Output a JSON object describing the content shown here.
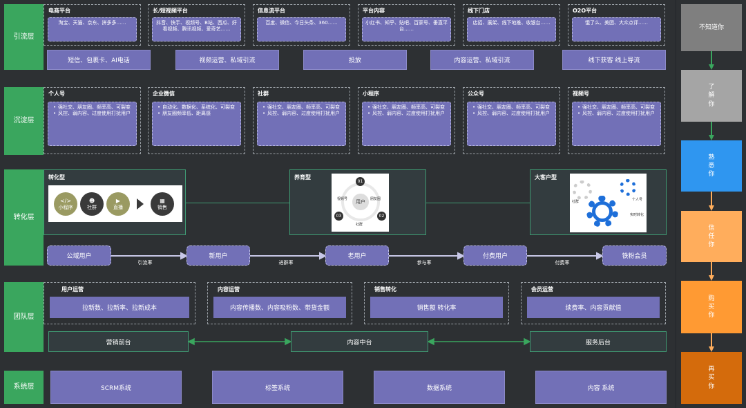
{
  "layers": {
    "l1": "引流层",
    "l2": "沉淀层",
    "l3": "转化层",
    "l4": "团队层",
    "l5": "系统层"
  },
  "traffic": {
    "platforms": [
      {
        "title": "电商平台",
        "desc": "淘宝、天猫、京东、拼多多……"
      },
      {
        "title": "长/短视频平台",
        "desc": "抖音、快手、视频号、B站、西瓜、好看视频、腾讯视频、爱奇艺……"
      },
      {
        "title": "信息流平台",
        "desc": "百度、微信、今日头条、360……"
      },
      {
        "title": "平台内容",
        "desc": "小红书、知乎、贴吧、百家号、垂直平台……"
      },
      {
        "title": "线下门店",
        "desc": "店招、展架、线下地推、收银台……"
      },
      {
        "title": "O2O平台",
        "desc": "饿了么、美团、大众点评……"
      }
    ],
    "methods": [
      "短信、包裹卡、AI电话",
      "视频运营、私域引流",
      "投放",
      "内容运营、私域引流",
      "线下获客 线上导流"
    ]
  },
  "retention": [
    {
      "title": "个人号",
      "bullets": [
        "强社交、朋友圈、频率高、可裂变",
        "风控、弱内容、过度使用打扰用户"
      ]
    },
    {
      "title": "企业微信",
      "bullets": [
        "自动化、数据化、系统化、可裂变",
        "朋友圈频率低、距离感"
      ]
    },
    {
      "title": "社群",
      "bullets": [
        "强社交、朋友圈、频率高、可裂变",
        "风控、弱内容、过度使用打扰用户"
      ]
    },
    {
      "title": "小程序",
      "bullets": [
        "强社交、朋友圈、频率高、可裂变",
        "风控、弱内容、过度使用打扰用户"
      ]
    },
    {
      "title": "公众号",
      "bullets": [
        "强社交、朋友圈、频率高、可裂变",
        "风控、弱内容、过度使用打扰用户"
      ]
    },
    {
      "title": "视频号",
      "bullets": [
        "强社交、朋友圈、频率高、可裂变",
        "风控、弱内容、过度使用打扰用户"
      ]
    }
  ],
  "conversion": {
    "types": {
      "t1": "转化型",
      "t2": "养育型",
      "t3": "大客户型"
    },
    "conv_flow": {
      "n1": "小程序",
      "n2": "社群",
      "n3": "直播",
      "n4": "销售"
    },
    "nurture": {
      "center": "用户",
      "c1": "01",
      "c2": "02",
      "c3": "03",
      "l_left": "视频号",
      "l_right": "朋友圈",
      "l_bottom": "社群"
    },
    "bigclient": {
      "g1": "社群",
      "g2": "个人号",
      "g3": "实时转化"
    },
    "funnel": [
      "公域用户",
      "新用户",
      "老用户",
      "付费用户",
      "铁粉会员"
    ],
    "rates": [
      "引流率",
      "进群率",
      "参与率",
      "付费率"
    ]
  },
  "team": {
    "roles": [
      {
        "title": "用户运营",
        "metric": "拉新数、拉新率、拉新成本"
      },
      {
        "title": "内容运营",
        "metric": "内容传播数、内容吸粉数、带货金额"
      },
      {
        "title": "销售转化",
        "metric": "销售额 转化率"
      },
      {
        "title": "会员运营",
        "metric": "续费率、内容贡献值"
      }
    ],
    "platforms": [
      "营销前台",
      "内容中台",
      "服务后台"
    ]
  },
  "systems": [
    "SCRM系统",
    "标签系统",
    "数据系统",
    "内容 系统"
  ],
  "journey": [
    {
      "label": "不知道你",
      "color": "#7f7f7f"
    },
    {
      "label": "了解你",
      "color": "#a5a5a5"
    },
    {
      "label": "熟悉你",
      "color": "#2f96f0"
    },
    {
      "label": "信任你",
      "color": "#ffad5c"
    },
    {
      "label": "购买你",
      "color": "#ff9a33"
    },
    {
      "label": "再买你",
      "color": "#d46b0c"
    }
  ]
}
